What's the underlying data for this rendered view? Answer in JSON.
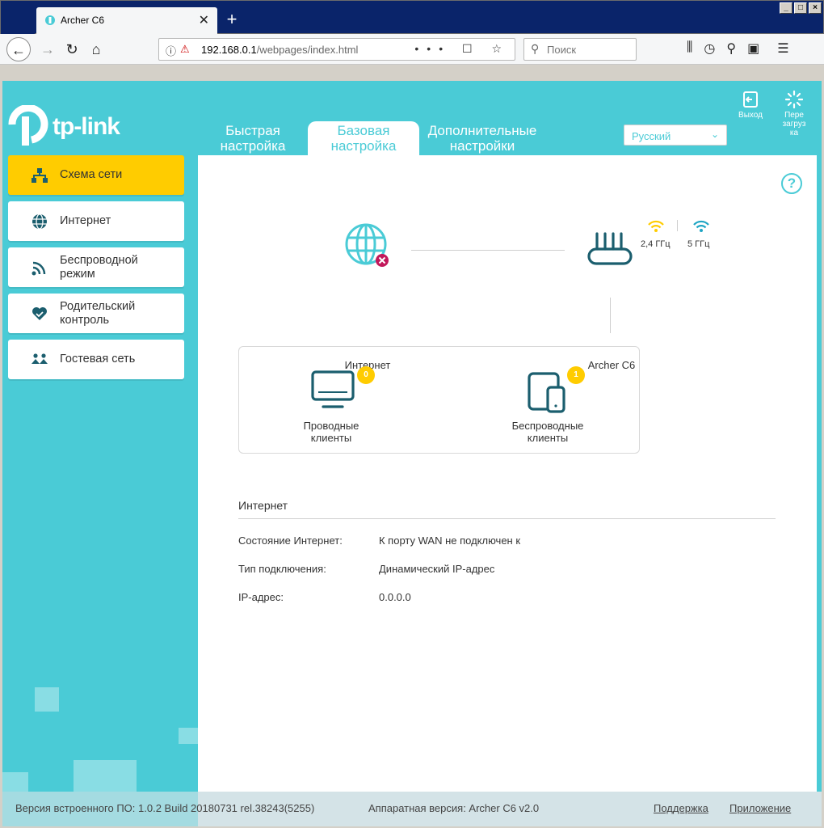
{
  "browser": {
    "tab_title": "Archer C6",
    "url_host": "192.168.0.1",
    "url_path": "/webpages/index.html",
    "search_placeholder": "Поиск",
    "url_actions": "••• ☐ ☆"
  },
  "header": {
    "logo_text": "tp-link",
    "tabs": [
      {
        "label_line1": "Быстрая",
        "label_line2": "настройка"
      },
      {
        "label_line1": "Базовая",
        "label_line2": "настройка"
      },
      {
        "label_line1": "Дополнительные",
        "label_line2": "настройки"
      }
    ],
    "language": "Русский",
    "logout_label": "Выход",
    "reboot_line1": "Пере",
    "reboot_line2": "загруз",
    "reboot_line3": "ка"
  },
  "sidebar": {
    "items": [
      {
        "label": "Схема сети",
        "icon": "network-map-icon"
      },
      {
        "label": "Интернет",
        "icon": "globe-icon"
      },
      {
        "label_line1": "Беспроводной",
        "label_line2": "режим",
        "icon": "wireless-icon"
      },
      {
        "label_line1": "Родительский",
        "label_line2": "контроль",
        "icon": "heart-hand-icon"
      },
      {
        "label": "Гостевая сеть",
        "icon": "guest-icon"
      }
    ]
  },
  "diagram": {
    "internet_label": "Интернет",
    "router_label": "Archer C6",
    "band_24": "2,4 ГГц",
    "band_5": "5 ГГц",
    "wired_count": "0",
    "wireless_count": "1",
    "wired_line1": "Проводные",
    "wired_line2": "клиенты",
    "wireless_line1": "Беспроводные",
    "wireless_line2": "клиенты"
  },
  "internet_info": {
    "title": "Интернет",
    "rows": [
      {
        "label": "Состояние Интернет:",
        "value": "К порту WAN не подключен к"
      },
      {
        "label": "Тип подключения:",
        "value": "Динамический IP-адрес"
      },
      {
        "label": "IP-адрес:",
        "value": "0.0.0.0"
      }
    ]
  },
  "footer": {
    "firmware": "Версия встроенного ПО: 1.0.2 Build 20180731 rel.38243(5255)",
    "hardware": "Аппаратная версия: Archer C6 v2.0",
    "support": "Поддержка",
    "app": "Приложение"
  },
  "colors": {
    "brand_teal": "#4acbd6",
    "active_yellow": "#ffcc00",
    "icon_dark": "#1b5e6e",
    "error_magenta": "#c2185b"
  }
}
